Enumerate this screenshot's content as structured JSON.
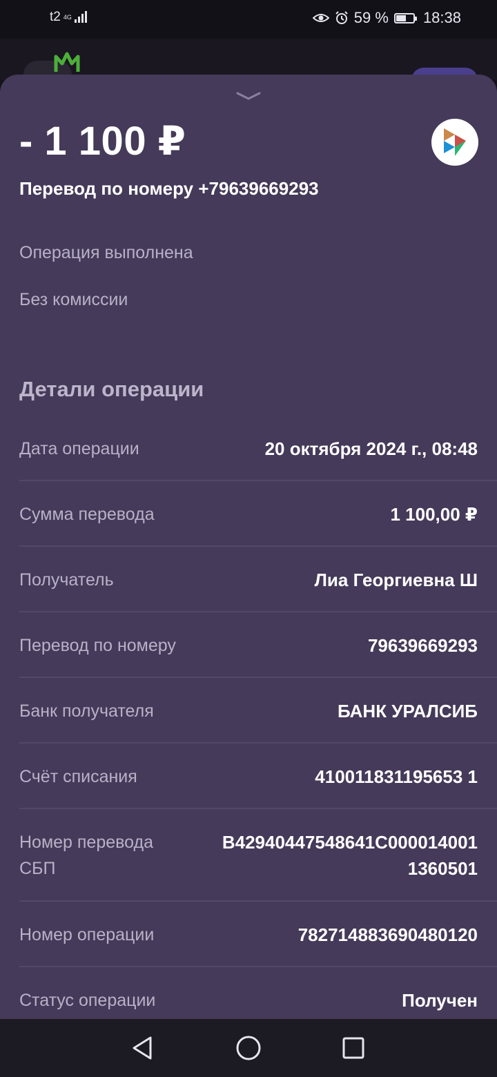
{
  "status_bar": {
    "carrier": "t2",
    "network": "4G",
    "battery_text": "59 %",
    "battery_level": 0.59,
    "time": "18:38"
  },
  "operation": {
    "amount": "- 1 100 ₽",
    "title": "Перевод по номеру +79639669293",
    "status": "Операция выполнена",
    "commission": "Без комиссии"
  },
  "details": {
    "section_title": "Детали операции",
    "rows": [
      {
        "label": "Дата операции",
        "value": "20 октября 2024 г., 08:48"
      },
      {
        "label": "Сумма перевода",
        "value": "1 100,00 ₽"
      },
      {
        "label": "Получатель",
        "value": "Лиа Георгиевна Ш"
      },
      {
        "label": "Перевод по номеру",
        "value": "79639669293"
      },
      {
        "label": "Банк получателя",
        "value": "БАНК УРАЛСИБ"
      },
      {
        "label": "Счёт списания",
        "value": "410011831195653 1"
      },
      {
        "label_line1": "Номер перевода",
        "label_line2": "СБП",
        "value_line1": "B42940447548641C000014001",
        "value_line2": "1360501"
      },
      {
        "label": "Номер операции",
        "value": "782714883690480120"
      },
      {
        "label": "Статус операции",
        "value": "Получен"
      }
    ]
  },
  "colors": {
    "sheet_bg": "#453a59",
    "label_text": "#b9b1c8",
    "divider": "#53486a"
  },
  "icons": {
    "handle": "chevron-down-icon",
    "sbp": "sbp-logo-icon",
    "nav_back": "back-triangle-icon",
    "nav_home": "home-circle-icon",
    "nav_recent": "recents-square-icon"
  }
}
